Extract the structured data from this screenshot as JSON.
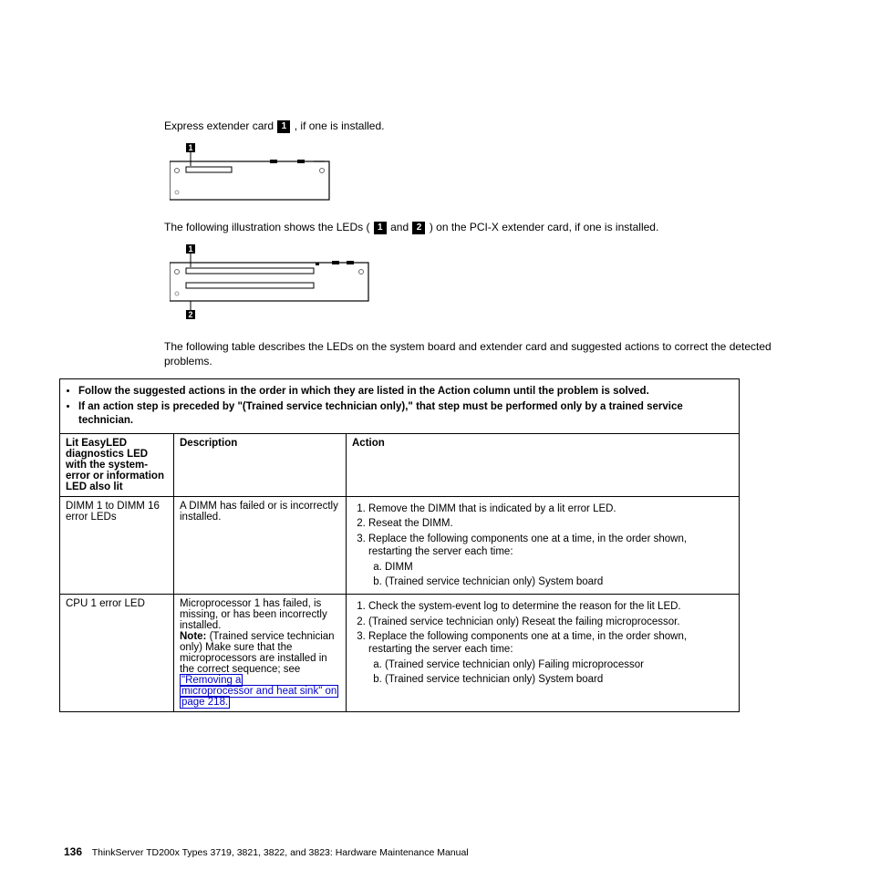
{
  "intro1_a": "Express extender card ",
  "intro1_b": " , if one is installed.",
  "mid_a": "The following illustration shows the LEDs ( ",
  "mid_and": " and ",
  "mid_b": " ) on the PCI-X extender card, if one is installed.",
  "para_tbl": "The following table describes the LEDs on the system board and extender card and suggested actions to correct the detected problems.",
  "notes": [
    "Follow the suggested actions in the order in which they are listed in the Action column until the problem is solved.",
    "If an action step is preceded by \"(Trained service technician only),\" that step must be performed only by a trained service technician."
  ],
  "headers": {
    "col1": "Lit EasyLED diagnostics LED with the system-error or information LED also lit",
    "col2": "Description",
    "col3": "Action"
  },
  "rows": [
    {
      "c1": "DIMM 1 to DIMM 16 error LEDs",
      "c2": "A DIMM has failed or is incorrectly installed.",
      "a1": "Remove the DIMM that is indicated by a lit error LED.",
      "a2": "Reseat the DIMM.",
      "a3": "Replace the following components one at a time, in the order shown, restarting the server each time:",
      "a3a": "DIMM",
      "a3b": "(Trained service technician only) System board"
    },
    {
      "c1": "CPU 1 error LED",
      "c2a": "Microprocessor 1 has failed, is missing, or has been incorrectly installed.",
      "c2b_label": "Note:",
      "c2b": " (Trained service technician only) Make sure that the microprocessors are installed in the correct sequence; see ",
      "c2link1": "\"Removing a",
      "c2link2": "microprocessor and heat sink\" on",
      "c2link3": "page 218.",
      "a1": "Check the system-event log to determine the reason for the lit LED.",
      "a2": "(Trained service technician only) Reseat the failing microprocessor.",
      "a3": "Replace the following components one at a time, in the order shown, restarting the server each time:",
      "a3a": "(Trained service technician only) Failing microprocessor",
      "a3b": "(Trained service technician only) System board"
    }
  ],
  "callouts": {
    "one": "1",
    "two": "2"
  },
  "footer": {
    "page": "136",
    "title": "ThinkServer TD200x Types 3719, 3821, 3822, and 3823: Hardware Maintenance Manual"
  }
}
